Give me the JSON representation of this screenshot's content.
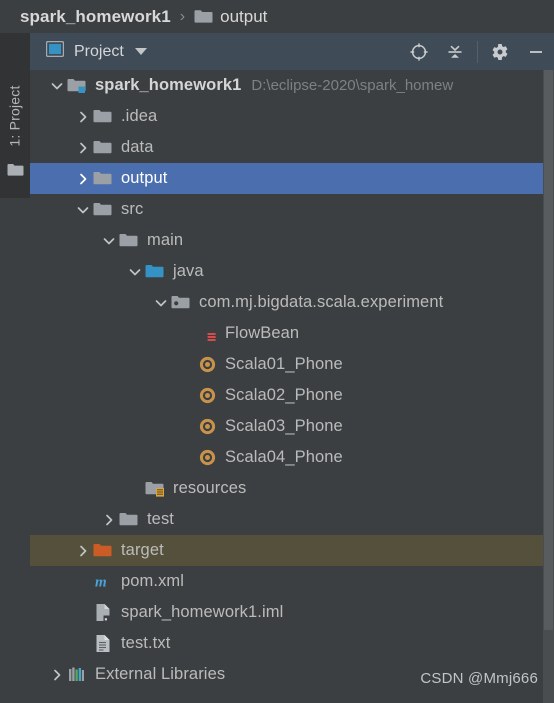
{
  "breadcrumb": {
    "project": "spark_homework1",
    "separator": "›",
    "folder_icon": "folder-icon",
    "current": "output"
  },
  "tool_strip": {
    "tab_label": "1: Project",
    "tab_icon": "folder-icon"
  },
  "panel": {
    "title": "Project",
    "title_icon": "project-view-icon",
    "dropdown_icon": "chevron-down-icon",
    "actions": [
      {
        "name": "locate-button",
        "icon": "crosshair-icon",
        "title": "Select Opened File"
      },
      {
        "name": "collapse-all-button",
        "icon": "collapse-all-icon",
        "title": "Collapse All"
      },
      {
        "name": "settings-button",
        "icon": "gear-icon",
        "title": "Settings"
      },
      {
        "name": "minimize-button",
        "icon": "minimize-icon",
        "title": "Hide"
      }
    ]
  },
  "tree": [
    {
      "id": "root",
      "label": "spark_homework1",
      "sublabel": "D:\\eclipse-2020\\spark_homew",
      "indent": 0,
      "arrow": "expanded",
      "icon": "module-folder-icon",
      "bold": true,
      "state": "normal"
    },
    {
      "id": "idea",
      "label": ".idea",
      "sublabel": "",
      "indent": 1,
      "arrow": "collapsed",
      "icon": "folder-icon",
      "bold": false,
      "state": "normal"
    },
    {
      "id": "data",
      "label": "data",
      "sublabel": "",
      "indent": 1,
      "arrow": "collapsed",
      "icon": "folder-icon",
      "bold": false,
      "state": "normal"
    },
    {
      "id": "output",
      "label": "output",
      "sublabel": "",
      "indent": 1,
      "arrow": "collapsed",
      "icon": "folder-icon",
      "bold": false,
      "state": "selected"
    },
    {
      "id": "src",
      "label": "src",
      "sublabel": "",
      "indent": 1,
      "arrow": "expanded",
      "icon": "folder-icon",
      "bold": false,
      "state": "normal"
    },
    {
      "id": "main",
      "label": "main",
      "sublabel": "",
      "indent": 2,
      "arrow": "expanded",
      "icon": "folder-icon",
      "bold": false,
      "state": "normal"
    },
    {
      "id": "java",
      "label": "java",
      "sublabel": "",
      "indent": 3,
      "arrow": "expanded",
      "icon": "source-root-icon",
      "bold": false,
      "state": "normal"
    },
    {
      "id": "package",
      "label": "com.mj.bigdata.scala.experiment",
      "sublabel": "",
      "indent": 4,
      "arrow": "expanded",
      "icon": "package-icon",
      "bold": false,
      "state": "normal"
    },
    {
      "id": "flowbean",
      "label": "FlowBean",
      "sublabel": "",
      "indent": 5,
      "arrow": "none",
      "icon": "scala-class-icon",
      "bold": false,
      "state": "normal"
    },
    {
      "id": "scala01",
      "label": "Scala01_Phone",
      "sublabel": "",
      "indent": 5,
      "arrow": "none",
      "icon": "scala-object-icon",
      "bold": false,
      "state": "normal"
    },
    {
      "id": "scala02",
      "label": "Scala02_Phone",
      "sublabel": "",
      "indent": 5,
      "arrow": "none",
      "icon": "scala-object-icon",
      "bold": false,
      "state": "normal"
    },
    {
      "id": "scala03",
      "label": "Scala03_Phone",
      "sublabel": "",
      "indent": 5,
      "arrow": "none",
      "icon": "scala-object-icon",
      "bold": false,
      "state": "normal"
    },
    {
      "id": "scala04",
      "label": "Scala04_Phone",
      "sublabel": "",
      "indent": 5,
      "arrow": "none",
      "icon": "scala-object-icon",
      "bold": false,
      "state": "normal"
    },
    {
      "id": "resources",
      "label": "resources",
      "sublabel": "",
      "indent": 3,
      "arrow": "none",
      "icon": "resource-root-icon",
      "bold": false,
      "state": "normal"
    },
    {
      "id": "test",
      "label": "test",
      "sublabel": "",
      "indent": 2,
      "arrow": "collapsed",
      "icon": "folder-icon",
      "bold": false,
      "state": "normal"
    },
    {
      "id": "target",
      "label": "target",
      "sublabel": "",
      "indent": 1,
      "arrow": "collapsed",
      "icon": "excluded-folder-icon",
      "bold": false,
      "state": "hovered"
    },
    {
      "id": "pom",
      "label": "pom.xml",
      "sublabel": "",
      "indent": 1,
      "arrow": "none",
      "icon": "maven-icon",
      "bold": false,
      "state": "normal"
    },
    {
      "id": "iml",
      "label": "spark_homework1.iml",
      "sublabel": "",
      "indent": 1,
      "arrow": "none",
      "icon": "iml-file-icon",
      "bold": false,
      "state": "normal"
    },
    {
      "id": "testtxt",
      "label": "test.txt",
      "sublabel": "",
      "indent": 1,
      "arrow": "none",
      "icon": "text-file-icon",
      "bold": false,
      "state": "normal"
    },
    {
      "id": "extlibs",
      "label": "External Libraries",
      "sublabel": "",
      "indent": 0,
      "arrow": "collapsed",
      "icon": "libraries-icon",
      "bold": false,
      "state": "normal"
    }
  ],
  "watermark": "CSDN @Mmj666",
  "colors": {
    "background": "#3c3f41",
    "panel_header": "#3f4b56",
    "selection": "#4b6eaf",
    "hover": "#55503c",
    "text": "#bbbbbb",
    "muted_text": "#7d8184",
    "source_root": "#3592c4",
    "excluded": "#cc5c26",
    "scala_object": "#c9924a"
  }
}
